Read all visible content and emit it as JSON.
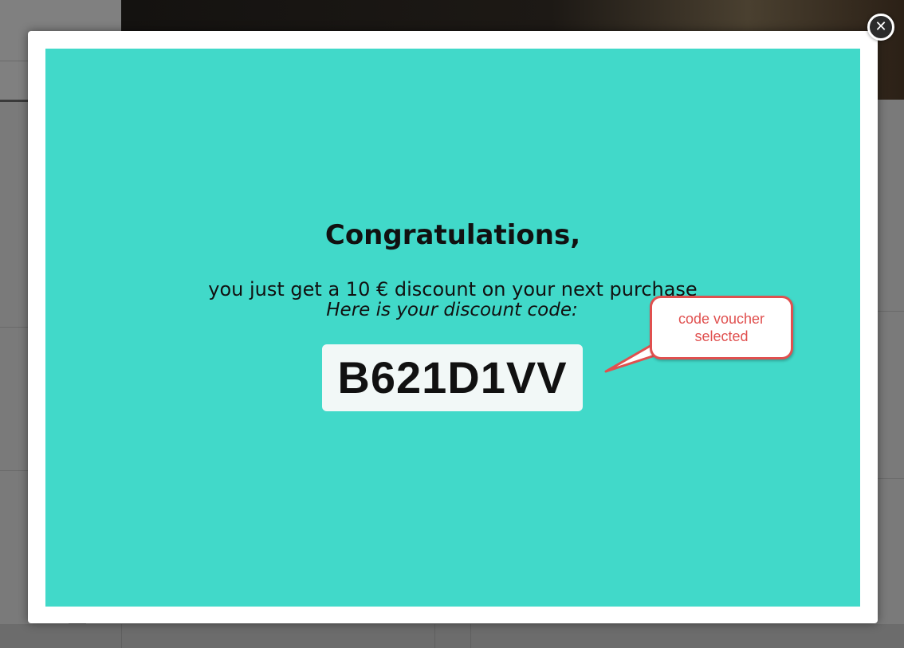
{
  "popup": {
    "title": "Congratulations,",
    "subtitle": "you just get a 10 € discount on your next purchase",
    "code_label": "Here is your discount code:",
    "discount_code": "B621D1VV",
    "close_icon": "close-icon"
  },
  "annotation": {
    "line1": "code voucher",
    "line2": "selected",
    "color": "#e0504f"
  },
  "colors": {
    "popup_background": "#41d9c9",
    "code_box_background": "#f2f8f7"
  }
}
